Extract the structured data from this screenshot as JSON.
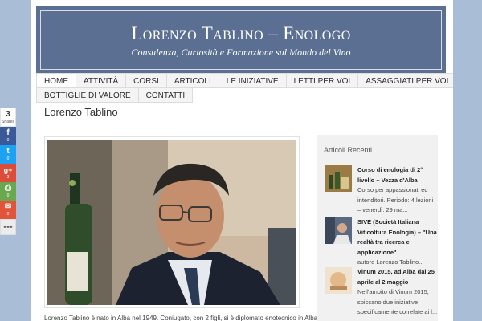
{
  "header": {
    "title": "Lorenzo Tablino – Enologo",
    "tagline": "Consulenza, Curiosità e Formazione sul Mondo del Vino"
  },
  "nav": {
    "row1": [
      "HOME",
      "ATTIVITÀ",
      "CORSI",
      "ARTICOLI",
      "LE INIZIATIVE",
      "LETTI PER VOI",
      "ASSAGGIATI PER VOI"
    ],
    "row2": [
      "BOTTIGLIE DI VALORE",
      "CONTATTI"
    ]
  },
  "post": {
    "title": "Lorenzo Tablino",
    "excerpt": "Lorenzo Tablino è nato in Alba nel 1949. Coniugato, con 2 figli, si è diplomato enotecnico in Alba"
  },
  "sidebar": {
    "widget_title": "Articoli Recenti",
    "items": [
      {
        "title": "Corso di enologia di 2° livello – Vezza d'Alba",
        "text": "Corso per appassionati ed intenditori. Periodo: 4 lezioni – venerdì: 29 ma..."
      },
      {
        "title": "SIVE (Società Italiana Viticoltura Enologia) – \"Una realtà tra ricerca e applicazione\"",
        "text": "autore Lorenzo Tablino..."
      },
      {
        "title": "Vinum 2015, ad Alba dal 25 aprile al 2 maggio",
        "text": "Nell'ambito di Vinum 2015, spiccano due iniziative specificamente correlate ai l..."
      }
    ]
  },
  "share": {
    "total": "3",
    "total_label": "Shares",
    "buttons": [
      {
        "name": "facebook",
        "glyph": "f",
        "count": "0",
        "color": "#3b5998"
      },
      {
        "name": "twitter",
        "glyph": "t",
        "count": "0",
        "color": "#1da1f2"
      },
      {
        "name": "google-plus",
        "glyph": "g+",
        "count": "3",
        "color": "#dd4b39"
      },
      {
        "name": "print",
        "glyph": "⎙",
        "count": "0",
        "color": "#6aa84f"
      },
      {
        "name": "email",
        "glyph": "✉",
        "count": "0",
        "color": "#e2543a"
      }
    ],
    "more": "•••"
  },
  "colors": {
    "header_bg": "#5b6f92",
    "page_bg": "#aabdd6",
    "sidebar_bg": "#f1f1f1"
  }
}
